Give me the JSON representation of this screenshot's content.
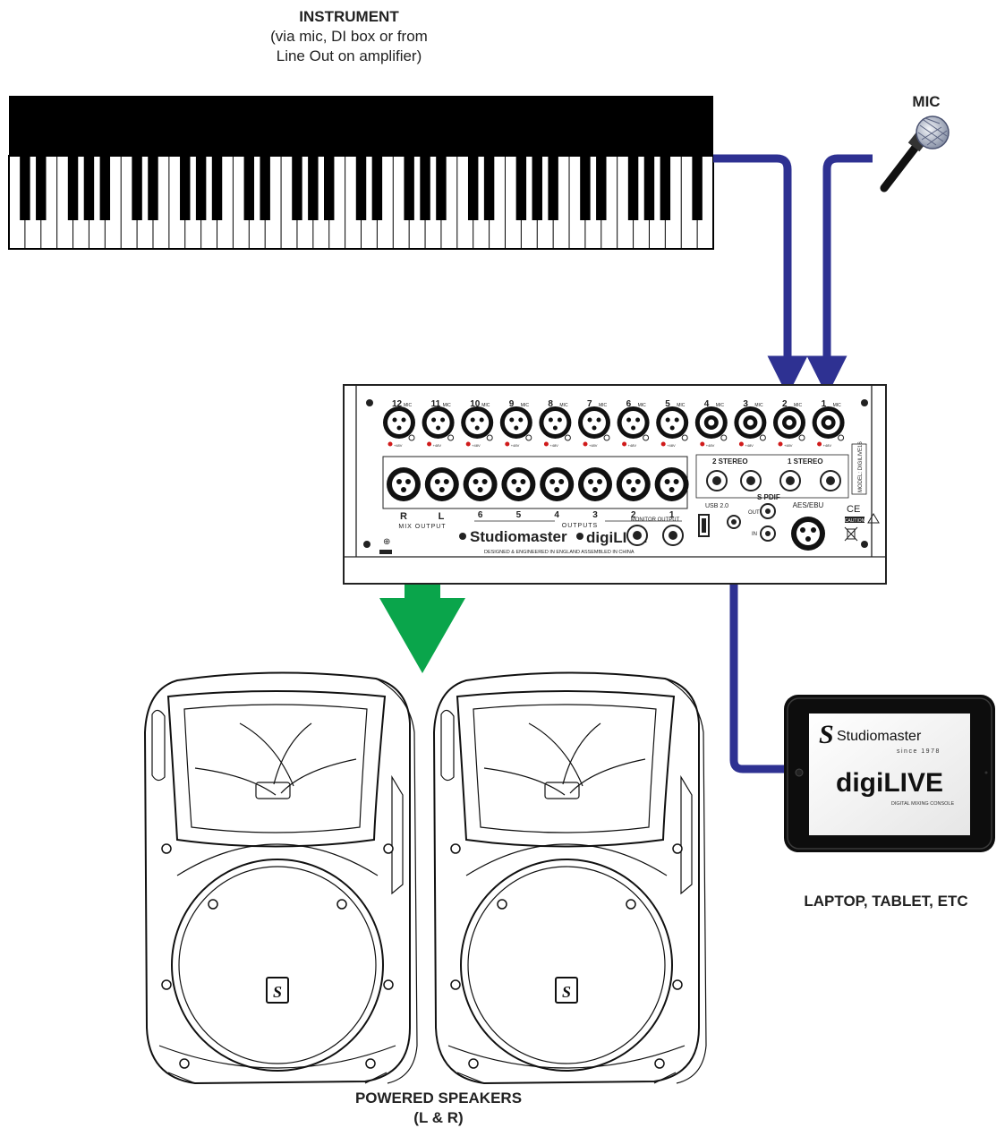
{
  "labels": {
    "instrument_title": "INSTRUMENT",
    "instrument_sub1": "(via mic, DI box or from",
    "instrument_sub2": "Line Out on amplifier)",
    "mic": "MIC",
    "speakers_title": "POWERED SPEAKERS",
    "speakers_sub": "(L & R)",
    "tablet": "LAPTOP, TABLET, ETC"
  },
  "mixer": {
    "mic_inputs": [
      "12",
      "11",
      "10",
      "9",
      "8",
      "7",
      "6",
      "5",
      "4",
      "3",
      "2",
      "1"
    ],
    "mic_suffix": "MIC",
    "phantom": "+48V",
    "outputs": [
      "6",
      "5",
      "4",
      "3",
      "2",
      "1"
    ],
    "outputs_label": "OUTPUTS",
    "mix_r": "R",
    "mix_l": "L",
    "mix_output": "MIX OUTPUT",
    "stereo2": "2 STEREO",
    "stereo1": "1 STEREO",
    "usb": "USB 2.0",
    "spdif": "S PDIF",
    "spdif_out": "OUT",
    "spdif_in": "IN",
    "aes": "AES/EBU",
    "monitor": "MONITOR OUTPUT",
    "model": "MODEL: DIGILIVE16",
    "ce": "CE",
    "caution": "CAUTION",
    "brand": "Studiomaster",
    "product": "digiLIVE",
    "designed": "DESIGNED & ENGINEERED IN ENGLAND   ASSEMBLED IN CHINA"
  },
  "tablet_screen": {
    "brand": "Studiomaster",
    "since": "since 1978",
    "product": "digiLIVE",
    "tagline": "DIGITAL MIXING CONSOLE"
  },
  "colors": {
    "cable": "#2e3192",
    "arrow": "#0aa54b"
  }
}
